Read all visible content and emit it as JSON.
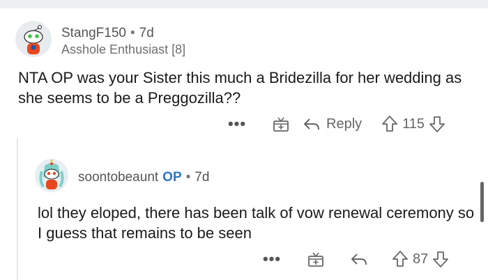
{
  "comments": [
    {
      "username": "StangF150",
      "separator": "•",
      "age": "7d",
      "flair": "Asshole Enthusiast [8]",
      "body": "NTA  OP was your Sister this much a Bridezilla for her wedding as she seems to be a Preggozilla??",
      "more": "•••",
      "reply_label": "Reply",
      "votes": "115"
    },
    {
      "username": "soontobeaunt",
      "op_tag": "OP",
      "separator": "•",
      "age": "7d",
      "body": "lol they eloped, there has been talk of vow renewal ceremony so I guess that remains to be seen",
      "more": "•••",
      "votes": "87"
    }
  ],
  "icons": {
    "award": "gift-icon",
    "reply": "reply-arrow-icon",
    "upvote": "upvote-arrow-icon",
    "downvote": "downvote-arrow-icon"
  },
  "colors": {
    "op": "#2d75c9",
    "text": "#1a1a1b",
    "meta": "#555555"
  }
}
